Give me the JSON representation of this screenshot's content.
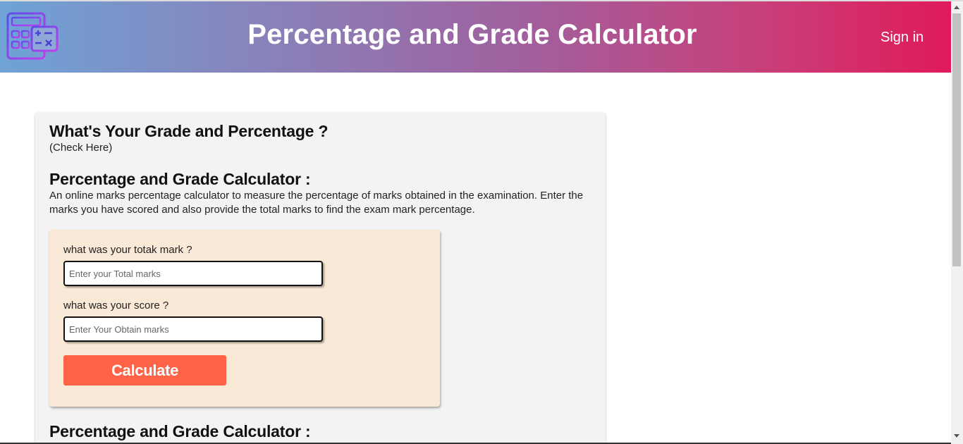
{
  "header": {
    "logo_icon": "calculator-icon",
    "title": "Percentage and Grade Calculator",
    "signin_label": "Sign in",
    "gradient_start": "#6fa3d6",
    "gradient_end": "#e01a5a"
  },
  "intro": {
    "heading": "What's Your Grade and Percentage ?",
    "subheading": "(Check Here)"
  },
  "about": {
    "heading": "Percentage and Grade Calculator :",
    "description": "An online marks percentage calculator to measure the percentage of marks obtained in the examination. Enter the marks you have scored and also provide the total marks to find the exam mark percentage."
  },
  "form": {
    "total_label": "what was your totak mark ?",
    "total_value": "",
    "total_placeholder": "Enter your Total marks",
    "score_label": "what was your score ?",
    "score_value": "",
    "score_placeholder": "Enter Your Obtain marks",
    "calculate_label": "Calculate",
    "button_color": "#ff6347",
    "box_color": "#fae9d7"
  },
  "section2": {
    "heading": "Percentage and Grade Calculator :"
  }
}
